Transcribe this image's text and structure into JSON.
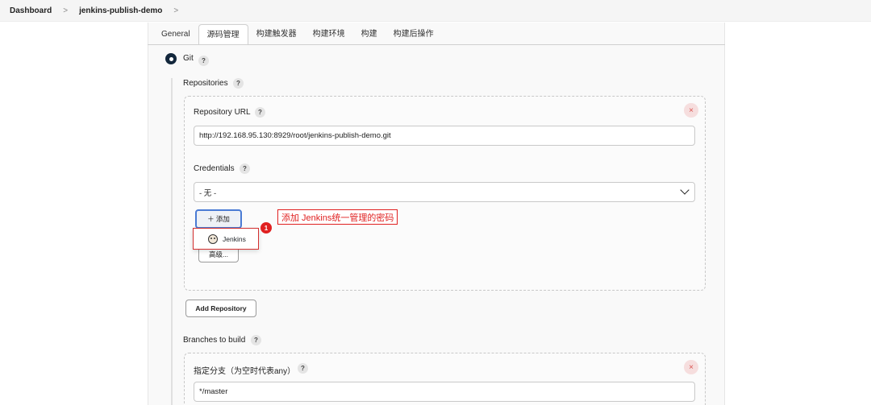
{
  "breadcrumb": {
    "items": [
      "Dashboard",
      "jenkins-publish-demo"
    ],
    "separator": ">"
  },
  "tabs": [
    "General",
    "源码管理",
    "构建触发器",
    "构建环境",
    "构建",
    "构建后操作"
  ],
  "active_tab": "源码管理",
  "scm": {
    "label": "Git",
    "help": "?"
  },
  "repositories": {
    "label": "Repositories",
    "url_label": "Repository URL",
    "url_value": "http://192.168.95.130:8929/root/jenkins-publish-demo.git",
    "credentials_label": "Credentials",
    "credentials_value": "- 无 -",
    "add_button": "＋ 添加",
    "advanced_button": "高级...",
    "popup_item": "Jenkins",
    "add_repository": "Add Repository",
    "remove": "×"
  },
  "annotation": {
    "badge": "1",
    "text": "添加 Jenkins统一管理的密码"
  },
  "branches": {
    "label": "Branches to build",
    "spec_label": "指定分支（为空时代表any）",
    "spec_value": "*/master",
    "remove": "×"
  },
  "colors": {
    "accent": "#13273c",
    "annotation": "#e02020",
    "add_border": "#4a7bd4"
  }
}
